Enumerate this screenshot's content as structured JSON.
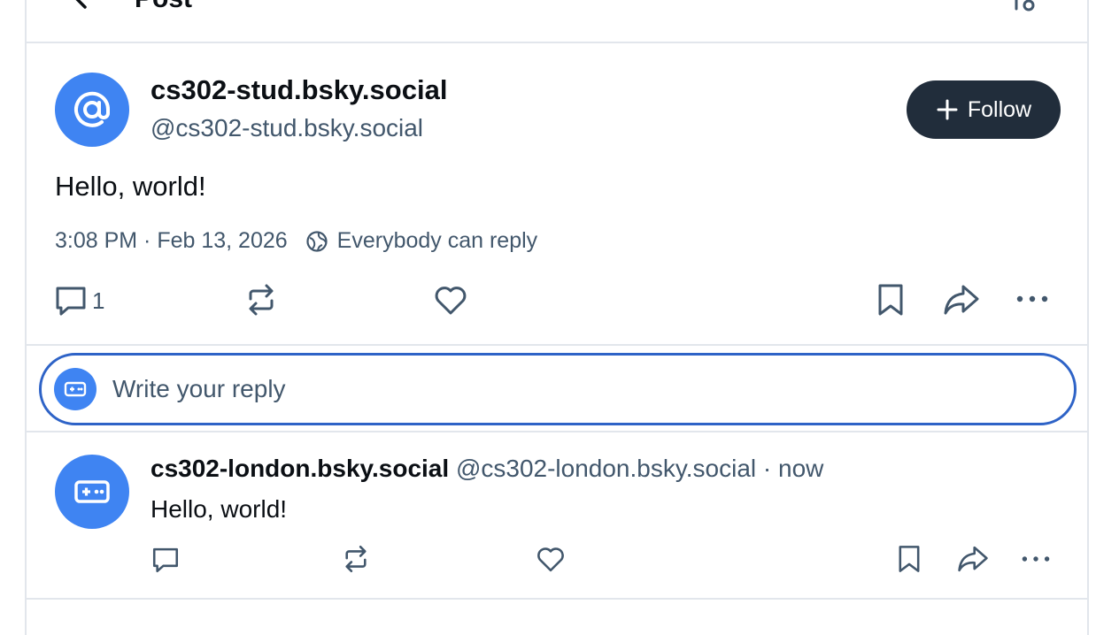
{
  "header": {
    "title": "Post",
    "back_icon": "chevron-left-icon",
    "right_icon": "sliders-icon"
  },
  "post": {
    "display_name": "cs302-stud.bsky.social",
    "handle": "@cs302-stud.bsky.social",
    "avatar_icon": "at-sign-icon",
    "follow_label": "Follow",
    "text": "Hello, world!",
    "timestamp": "3:08 PM · Feb 13, 2026",
    "reply_setting": "Everybody can reply",
    "reply_count": "1"
  },
  "composer": {
    "placeholder": "Write your reply",
    "avatar_icon": "gamepad-icon"
  },
  "reply": {
    "display_name": "cs302-london.bsky.social",
    "handle": "@cs302-london.bsky.social",
    "separator": "·",
    "time": "now",
    "text": "Hello, world!",
    "avatar_icon": "gamepad-icon"
  },
  "colors": {
    "accent": "#3f84f2",
    "follow_bg": "#212d3b",
    "focus_border": "#2e63c7",
    "muted_text": "#42576c",
    "border": "#e2e6ec"
  }
}
